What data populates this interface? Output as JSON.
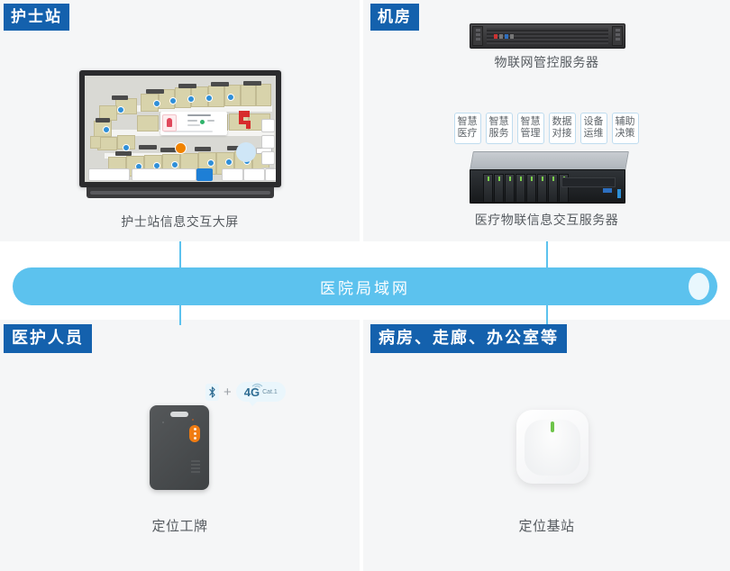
{
  "sections": {
    "nurse_station": {
      "tag": "护士站",
      "caption": "护士站信息交互大屏"
    },
    "equipment_room": {
      "tag": "机房",
      "server_1u_caption": "物联网管控服务器",
      "server_2u_caption": "医疗物联信息交互服务器",
      "features": [
        {
          "line1": "智慧",
          "line2": "医疗"
        },
        {
          "line1": "智慧",
          "line2": "服务"
        },
        {
          "line1": "智慧",
          "line2": "管理"
        },
        {
          "line1": "数据",
          "line2": "对接"
        },
        {
          "line1": "设备",
          "line2": "运维"
        },
        {
          "line1": "辅助",
          "line2": "决策"
        }
      ]
    },
    "medical_staff": {
      "tag": "医护人员",
      "caption": "定位工牌",
      "connectivity": {
        "bluetooth_icon": "bluetooth-icon",
        "plus": "+",
        "cellular_label": "4G",
        "cellular_category": "Cat.1"
      }
    },
    "rooms": {
      "tag": "病房、走廊、办公室等",
      "caption": "定位基站"
    }
  },
  "network": {
    "label": "医院局域网"
  },
  "colors": {
    "tag_blue": "#1461ad",
    "lan_blue": "#5cc2ee",
    "panel_gray": "#f5f6f7",
    "caption_gray": "#555a5f",
    "sos_orange": "#f07c12",
    "led_green": "#6ec44a"
  }
}
